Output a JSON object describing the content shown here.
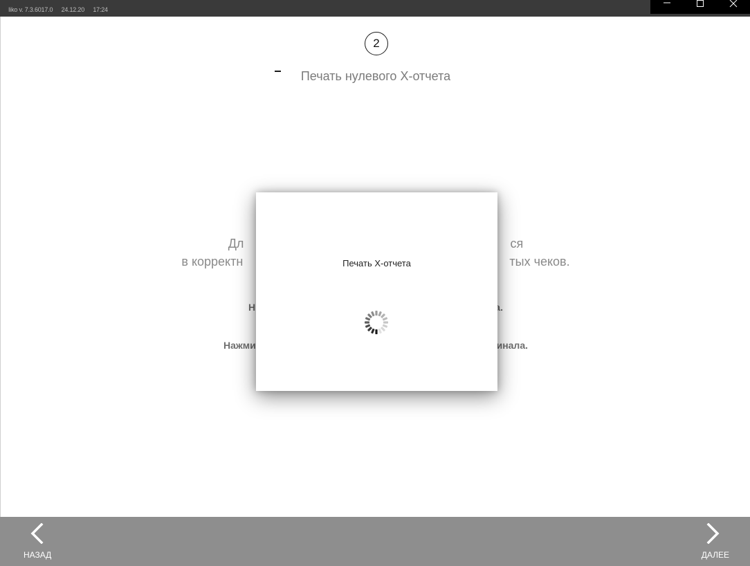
{
  "titlebar": {
    "app_version": "Iiko v. 7.3.6017.0",
    "date": "24.12.20",
    "time": "17:24",
    "icons": [
      "minimize-icon",
      "maximize-icon",
      "close-icon"
    ]
  },
  "step": {
    "number": "2",
    "title": "Печать нулевого X-отчета"
  },
  "background_text": {
    "line1": "Дл                                                                             ся",
    "line2": "в корректн                                                                             тых чеков.",
    "line3": "Н                                                                                         а.",
    "line4": "Нажмит                                                                                     минала."
  },
  "dialog": {
    "message": "Печать X-отчета",
    "spinner_icon": "loading-spinner-icon"
  },
  "navigation": {
    "back_label": "НАЗАД",
    "next_label": "ДАЛЕЕ",
    "back_icon": "chevron-left-icon",
    "next_icon": "chevron-right-icon"
  },
  "colors": {
    "titlebar": "#3a3a3a",
    "bottombar": "#8e8e8e",
    "dialog_bg": "#ffffff"
  }
}
